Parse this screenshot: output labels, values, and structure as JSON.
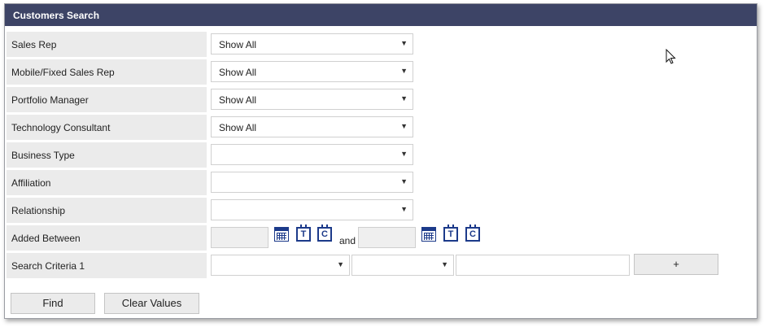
{
  "header": {
    "title": "Customers Search"
  },
  "rows": [
    {
      "label": "Sales Rep",
      "value": "Show All"
    },
    {
      "label": "Mobile/Fixed Sales Rep",
      "value": "Show All"
    },
    {
      "label": "Portfolio Manager",
      "value": "Show All"
    },
    {
      "label": "Technology Consultant",
      "value": "Show All"
    },
    {
      "label": "Business Type",
      "value": ""
    },
    {
      "label": "Affiliation",
      "value": ""
    },
    {
      "label": "Relationship",
      "value": ""
    }
  ],
  "added_between": {
    "label": "Added Between",
    "and": "and",
    "today_glyph": "T",
    "clear_glyph": "C"
  },
  "search_criteria": {
    "label": "Search Criteria 1",
    "field_value": "",
    "operator_value": "",
    "text_value": "",
    "add_label": "+"
  },
  "buttons": {
    "find": "Find",
    "clear": "Clear Values"
  },
  "icons": {
    "calendar": "calendar-icon",
    "today": "today-icon",
    "clear": "clear-date-icon",
    "dropdown": "chevron-down-icon",
    "cursor": "mouse-pointer-icon"
  },
  "colors": {
    "header_bg": "#3d4466",
    "label_bg": "#ebebeb",
    "icon_blue": "#1c3a8a"
  }
}
